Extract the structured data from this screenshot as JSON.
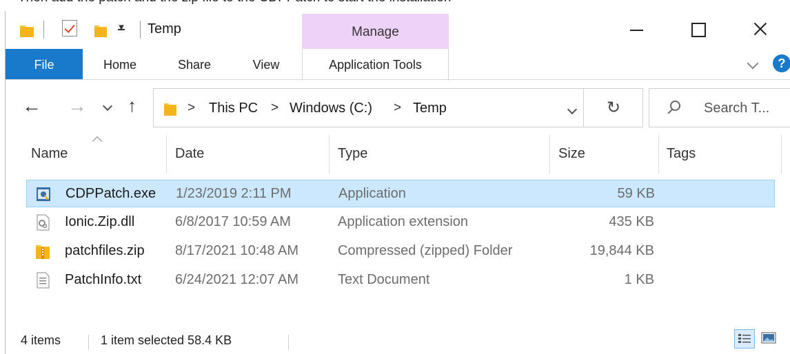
{
  "app": {
    "window_title": "Temp",
    "context_tab": "Manage"
  },
  "ribbon": {
    "tabs": [
      "File",
      "Home",
      "Share",
      "View",
      "Application Tools"
    ],
    "help": "?"
  },
  "nav": {
    "breadcrumb": [
      "This PC",
      "Windows (C:)",
      "Temp"
    ],
    "search_placeholder": "Search T..."
  },
  "columns": {
    "name": "Name",
    "date": "Date",
    "type": "Type",
    "size": "Size",
    "tags": "Tags"
  },
  "files": [
    {
      "name": "CDPPatch.exe",
      "date": "1/23/2019 2:11 PM",
      "type": "Application",
      "size": "59 KB",
      "icon": "exe-icon",
      "selected": true
    },
    {
      "name": "Ionic.Zip.dll",
      "date": "6/8/2017 10:59 AM",
      "type": "Application extension",
      "size": "435 KB",
      "icon": "dll-icon",
      "selected": false
    },
    {
      "name": "patchfiles.zip",
      "date": "8/17/2021 10:48 AM",
      "type": "Compressed (zipped) Folder",
      "size": "19,844 KB",
      "icon": "zip-folder-icon",
      "selected": false
    },
    {
      "name": "PatchInfo.txt",
      "date": "6/24/2021 12:07 AM",
      "type": "Text Document",
      "size": "1 KB",
      "icon": "text-file-icon",
      "selected": false
    }
  ],
  "status": {
    "item_count": "4 items",
    "selection": "1 item selected  58.4 KB"
  },
  "colors": {
    "file_tab": "#1979ca",
    "manage_tab": "#eed2f7",
    "selection_bg": "#cce8ff",
    "selection_border": "#99d1ff",
    "folder_yellow": "#f8c53a"
  }
}
